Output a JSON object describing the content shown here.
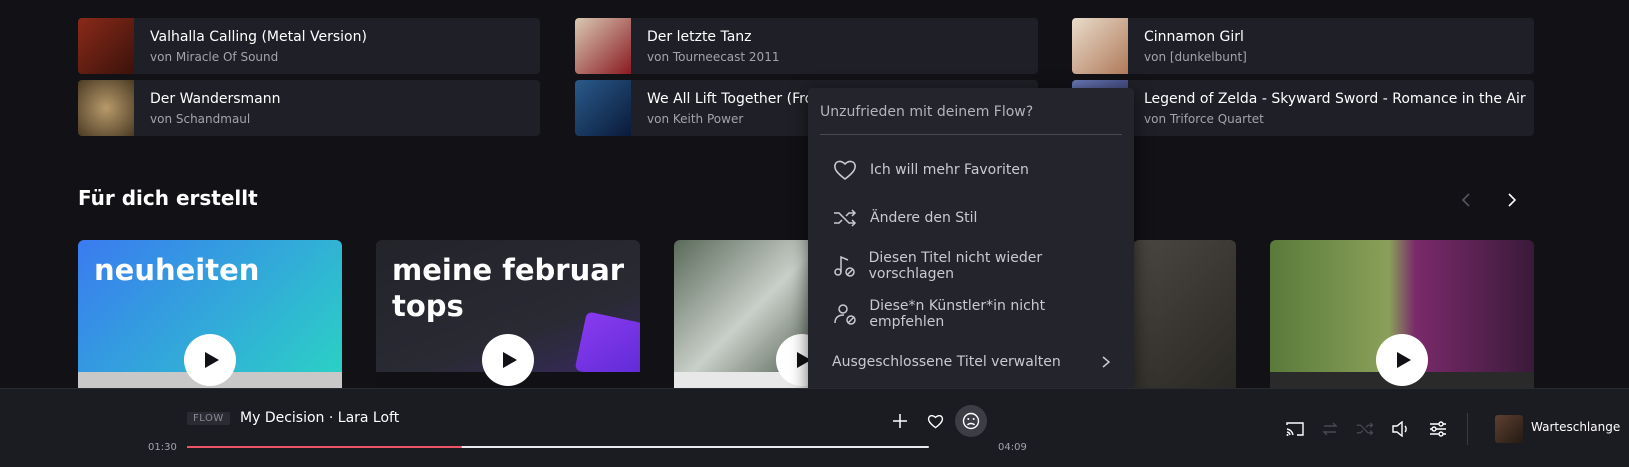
{
  "tracks": [
    {
      "title": "Valhalla Calling (Metal Version)",
      "artist": "von Miracle Of Sound"
    },
    {
      "title": "Der letzte Tanz",
      "artist": "von Tourneecast 2011"
    },
    {
      "title": "Cinnamon Girl",
      "artist": "von [dunkelbunt]"
    },
    {
      "title": "Der Wandersmann",
      "artist": "von Schandmaul"
    },
    {
      "title": "We All Lift Together (Fron",
      "artist": "von Keith Power"
    },
    {
      "title": "Legend of Zelda - Skyward Sword - Romance in the Air",
      "artist": "von Triforce Quartet"
    }
  ],
  "section": {
    "title": "Für dich erstellt"
  },
  "flows": [
    {
      "label": "neuheiten"
    },
    {
      "label": "meine februar tops"
    }
  ],
  "popup": {
    "heading": "Unzufrieden mit deinem Flow?",
    "items": [
      {
        "label": "Ich will mehr Favoriten",
        "icon": "heart-icon"
      },
      {
        "label": "Ändere den Stil",
        "icon": "shuffle-icon"
      },
      {
        "label": "Diesen Titel nicht wieder vorschlagen",
        "icon": "music-note-block-icon"
      },
      {
        "label": "Diese*n Künstler*in nicht empfehlen",
        "icon": "user-block-icon"
      }
    ],
    "manage": "Ausgeschlossene Titel verwalten"
  },
  "player": {
    "badge": "FLOW",
    "now_playing": "My Decision · Lara Loft",
    "elapsed": "01:30",
    "duration": "04:09",
    "progress": 0.37,
    "queue_label": "Warteschlange",
    "accent": "#ef5466"
  }
}
